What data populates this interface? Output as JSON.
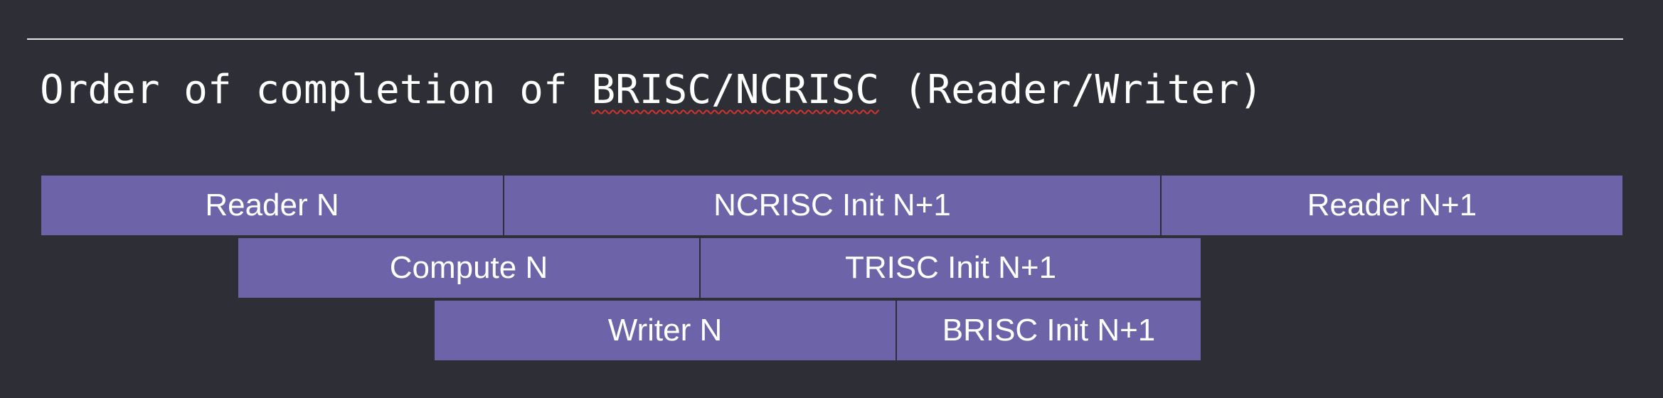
{
  "title": {
    "prefix": "Order of completion of ",
    "flagged": "BRISC/NCRISC",
    "suffix": " (Reader/Writer)"
  },
  "rows": [
    {
      "name": "reader-row",
      "blocks": [
        {
          "label": "Reader N"
        },
        {
          "label": "NCRISC Init N+1"
        },
        {
          "label": "Reader N+1"
        }
      ]
    },
    {
      "name": "compute-row",
      "blocks": [
        {
          "label": "Compute N"
        },
        {
          "label": "TRISC Init N+1"
        }
      ]
    },
    {
      "name": "writer-row",
      "blocks": [
        {
          "label": "Writer N"
        },
        {
          "label": "BRISC Init N+1"
        }
      ]
    }
  ],
  "colors": {
    "background": "#2e2e36",
    "block_fill": "#6c63a8",
    "text": "#ffffff",
    "rule": "#e6e6e6",
    "spellcheck_underline": "#d0342c"
  }
}
